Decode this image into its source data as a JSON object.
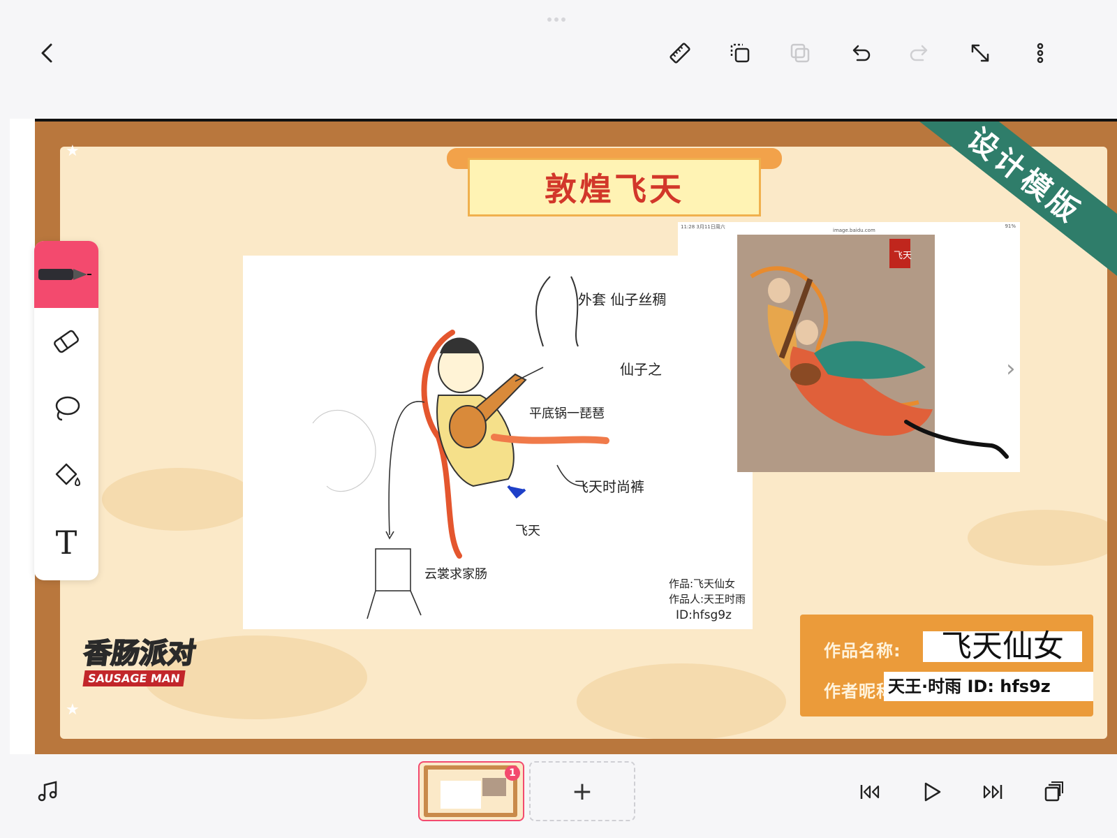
{
  "toolbar": {
    "back_icon": "chevron-left-icon",
    "ruler_icon": "ruler-icon",
    "paste_icon": "paste-icon",
    "duplicate_icon": "duplicate-icon",
    "undo_icon": "undo-icon",
    "redo_icon": "redo-icon",
    "resize_icon": "resize-icon",
    "more_icon": "more-vertical-icon"
  },
  "poster": {
    "title": "敦煌飞天",
    "ribbon_text": "设计模版",
    "sketch_labels": {
      "coat": "外套 仙子丝稠",
      "fairy": "仙子之",
      "pan": "平底锅一琵琶",
      "pants": "飞天时尚裤",
      "feitian": "飞天",
      "cloud": "云裳求家肠",
      "credit_work": "作品:飞天仙女",
      "credit_author": "作品人:天王时雨",
      "credit_id": "ID:hfsg9z"
    },
    "ref_status_left": "11:28 3月11日周六",
    "ref_status_center": "image.baidu.com",
    "ref_status_right": "91%",
    "ref_stamp": "飞天",
    "logo_cn": "香肠派对",
    "logo_en": "SAUSAGE MAN",
    "info": {
      "work_label": "作品名称:",
      "work_value": "飞天仙女",
      "author_label": "作者昵称",
      "author_value": "天王·时雨    ID: hfs9z"
    }
  },
  "tools": [
    {
      "name": "pen-icon",
      "active": true
    },
    {
      "name": "eraser-icon"
    },
    {
      "name": "lasso-icon"
    },
    {
      "name": "fill-bucket-icon"
    },
    {
      "name": "text-tool-icon",
      "glyph": "T"
    }
  ],
  "bottom": {
    "music_icon": "music-note-icon",
    "slide_badge": "1",
    "add_slide": "+",
    "first_icon": "skip-first-icon",
    "play_icon": "play-icon",
    "last_icon": "skip-last-icon",
    "layers_icon": "layers-icon"
  },
  "colors": {
    "accent": "#f34a6e",
    "poster_frame": "#b9773d",
    "poster_bg": "#fbe9c8",
    "title_red": "#d2372a",
    "ribbon_green": "#2f7d6a",
    "info_orange": "#eb9b3a"
  }
}
